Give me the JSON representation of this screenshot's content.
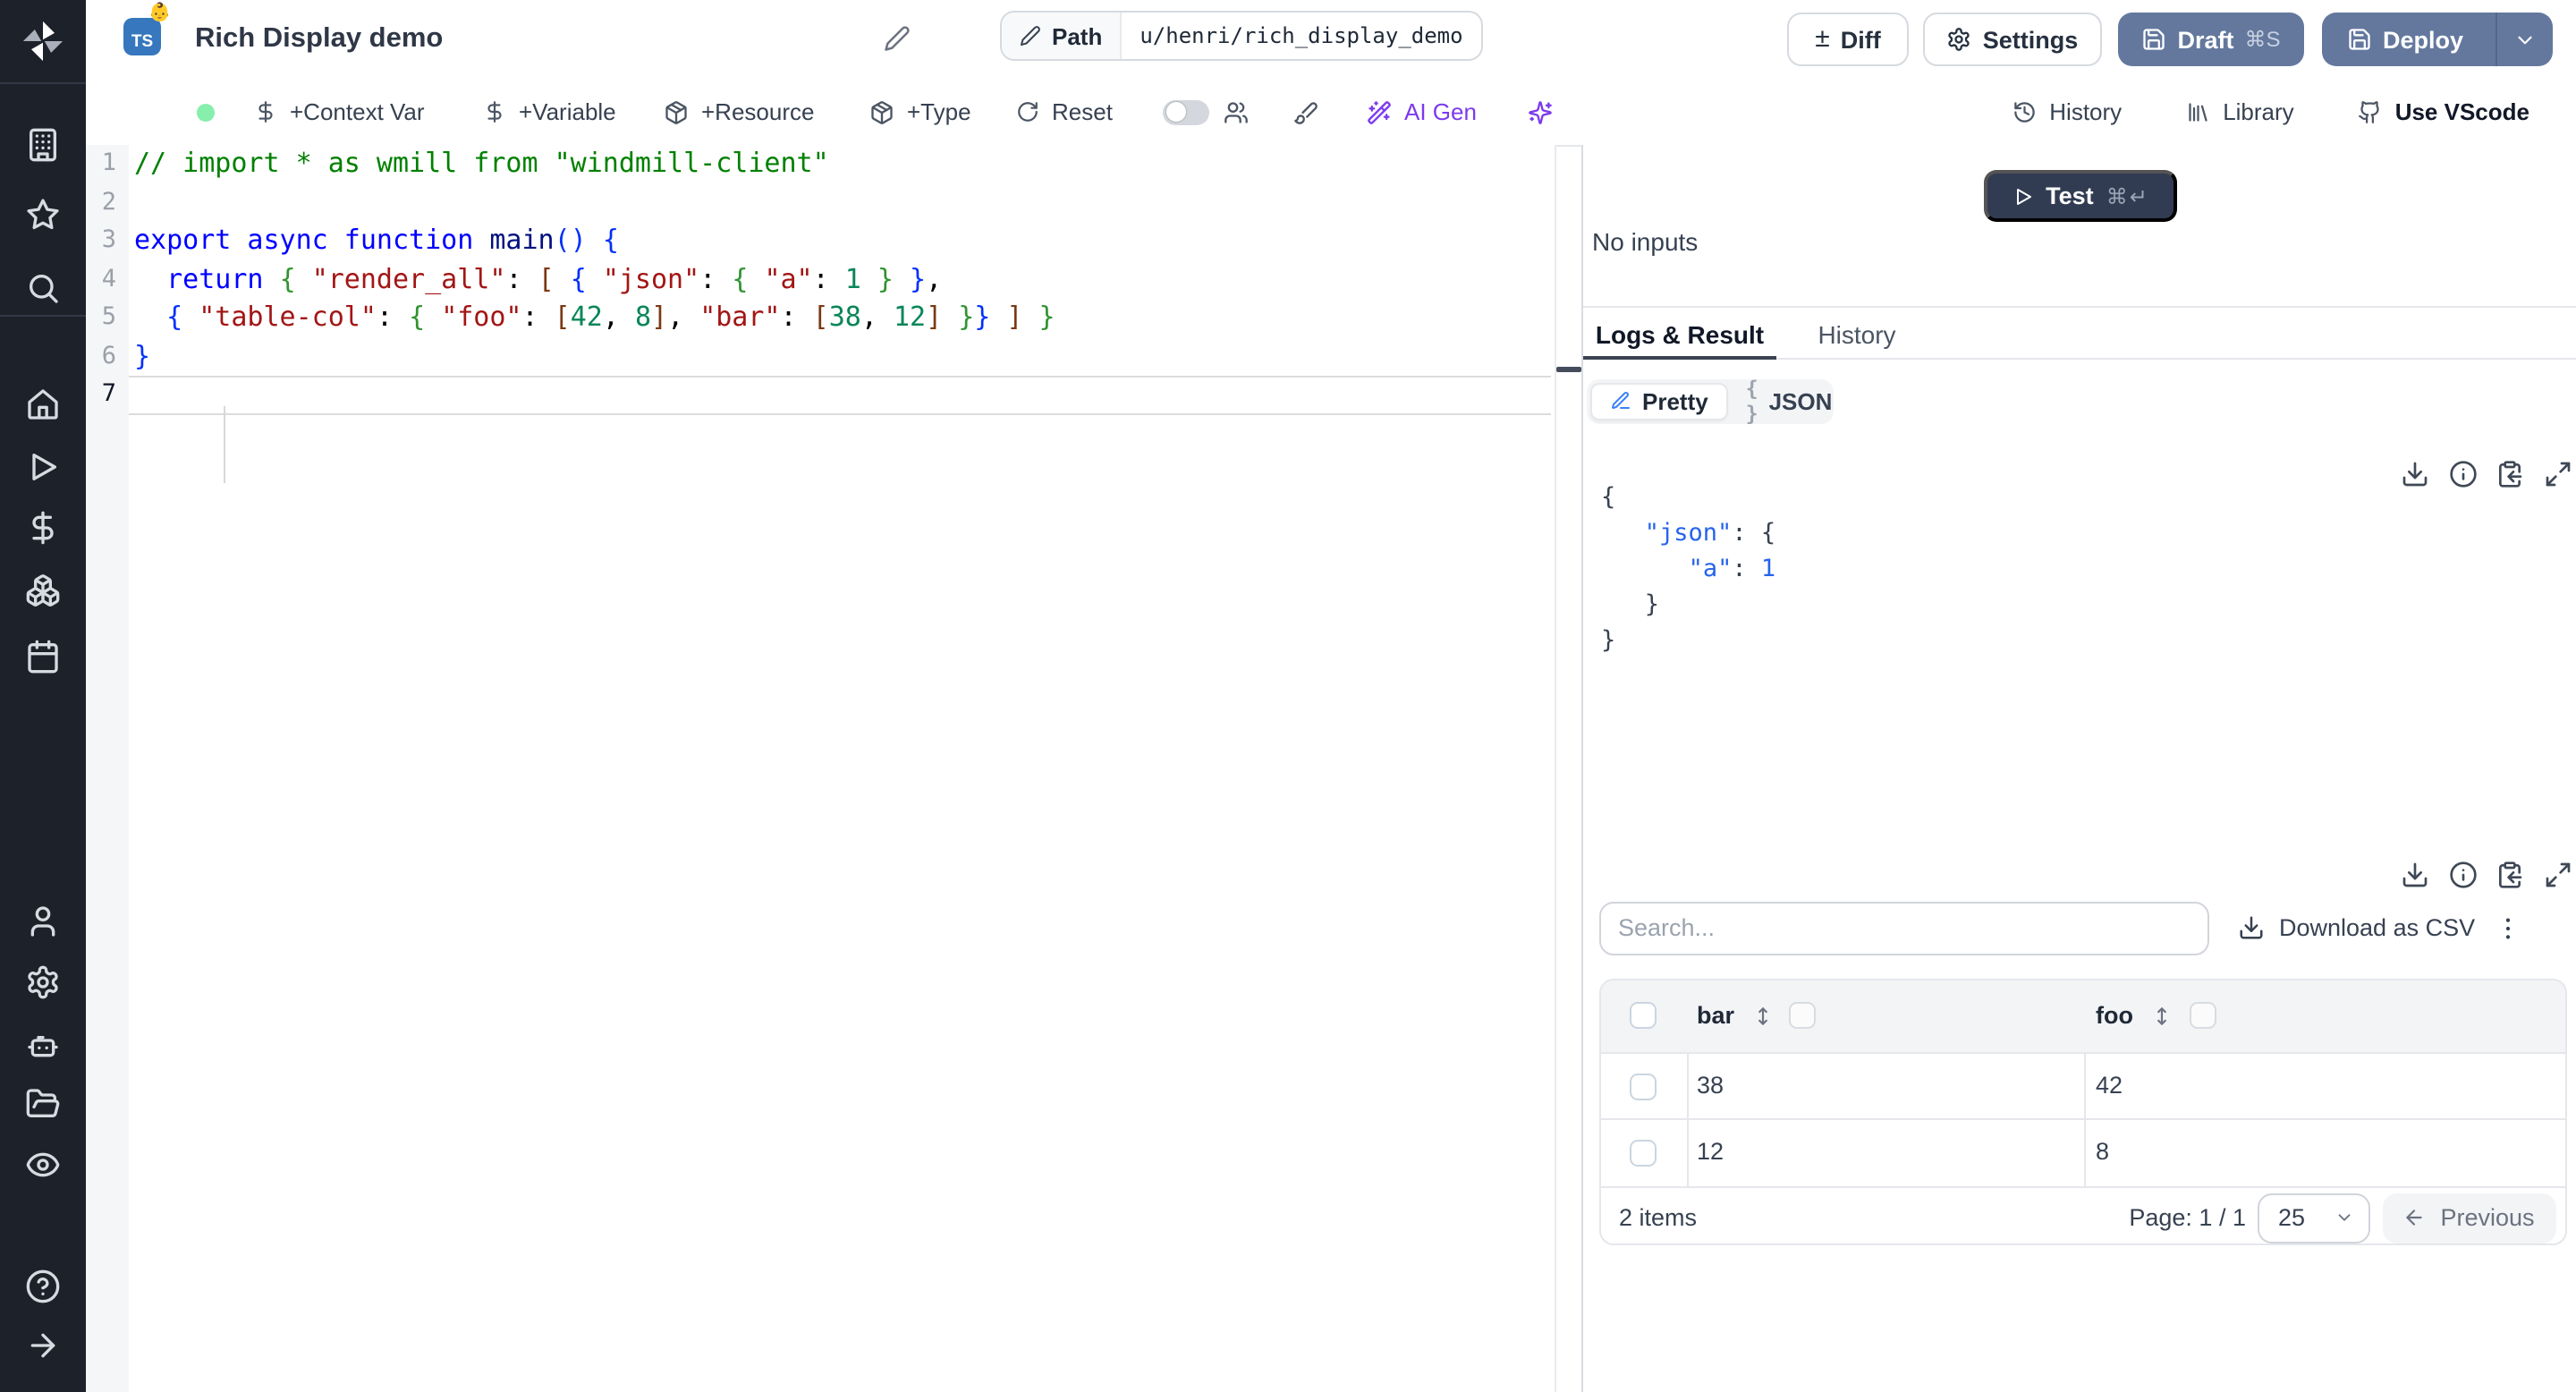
{
  "header": {
    "title": "Rich Display demo",
    "lang_badge": "TS",
    "emoji": "👶",
    "path_label": "Path",
    "path_value": "u/henri/rich_display_demo",
    "diff_label": "Diff",
    "plus_minus": "±",
    "settings_label": "Settings",
    "draft_label": "Draft",
    "draft_shortcut": "⌘S",
    "deploy_label": "Deploy"
  },
  "toolbar": {
    "context_var": "+Context Var",
    "variable": "+Variable",
    "resource": "+Resource",
    "type": "+Type",
    "reset": "Reset",
    "ai_gen": "AI Gen",
    "history": "History",
    "library": "Library",
    "use_vscode": "Use VScode",
    "status_color": "#86efac",
    "accent_purple": "#7c3aed"
  },
  "sidebar": {
    "groups": [
      [
        "building",
        "star",
        "search"
      ],
      [
        "home",
        "play",
        "dollar",
        "cubes",
        "calendar"
      ],
      [
        "user",
        "gear",
        "robot",
        "folder",
        "eye"
      ],
      [
        "help",
        "arrow-right"
      ]
    ],
    "background": "#1d212a"
  },
  "editor": {
    "active_line": 7,
    "line_numbers": [
      "1",
      "2",
      "3",
      "4",
      "5",
      "6",
      "7"
    ],
    "lines": [
      [
        [
          "// import * as wmill from \"windmill-client\"",
          "c"
        ]
      ],
      [],
      [
        [
          "export async function ",
          "k"
        ],
        [
          "main",
          "i"
        ],
        [
          "(",
          "b1"
        ],
        [
          ")",
          "b1"
        ],
        [
          " ",
          "p"
        ],
        [
          "{",
          "b1"
        ]
      ],
      [
        [
          "  ",
          "p"
        ],
        [
          "return",
          "k"
        ],
        [
          " ",
          "p"
        ],
        [
          "{",
          "b2"
        ],
        [
          " ",
          "p"
        ],
        [
          "\"render_all\"",
          "s"
        ],
        [
          ":",
          "p"
        ],
        [
          " ",
          "p"
        ],
        [
          "[",
          "b3"
        ],
        [
          " ",
          "p"
        ],
        [
          "{",
          "b1"
        ],
        [
          " ",
          "p"
        ],
        [
          "\"json\"",
          "s"
        ],
        [
          ":",
          "p"
        ],
        [
          " ",
          "p"
        ],
        [
          "{",
          "b2"
        ],
        [
          " ",
          "p"
        ],
        [
          "\"a\"",
          "s"
        ],
        [
          ":",
          "p"
        ],
        [
          " ",
          "p"
        ],
        [
          "1",
          "n"
        ],
        [
          " ",
          "p"
        ],
        [
          "}",
          "b2"
        ],
        [
          " ",
          "p"
        ],
        [
          "}",
          "b1"
        ],
        [
          ",",
          "p"
        ]
      ],
      [
        [
          "  ",
          "p"
        ],
        [
          "{",
          "b1"
        ],
        [
          " ",
          "p"
        ],
        [
          "\"table-col\"",
          "s"
        ],
        [
          ":",
          "p"
        ],
        [
          " ",
          "p"
        ],
        [
          "{",
          "b2"
        ],
        [
          " ",
          "p"
        ],
        [
          "\"foo\"",
          "s"
        ],
        [
          ":",
          "p"
        ],
        [
          " ",
          "p"
        ],
        [
          "[",
          "b3"
        ],
        [
          "42",
          "n"
        ],
        [
          ",",
          "p"
        ],
        [
          " ",
          "p"
        ],
        [
          "8",
          "n"
        ],
        [
          "]",
          "b3"
        ],
        [
          ",",
          "p"
        ],
        [
          " ",
          "p"
        ],
        [
          "\"bar\"",
          "s"
        ],
        [
          ":",
          "p"
        ],
        [
          " ",
          "p"
        ],
        [
          "[",
          "b3"
        ],
        [
          "38",
          "n"
        ],
        [
          ",",
          "p"
        ],
        [
          " ",
          "p"
        ],
        [
          "12",
          "n"
        ],
        [
          "]",
          "b3"
        ],
        [
          " ",
          "p"
        ],
        [
          "}",
          "b2"
        ],
        [
          "}",
          "b1"
        ],
        [
          " ",
          "p"
        ],
        [
          "]",
          "b3"
        ],
        [
          " ",
          "p"
        ],
        [
          "}",
          "b2"
        ]
      ],
      [
        [
          "}",
          "b1"
        ]
      ],
      []
    ]
  },
  "run": {
    "test_label": "Test",
    "test_shortcut": "⌘↵",
    "no_inputs": "No inputs"
  },
  "tabs": {
    "logs": "Logs & Result",
    "history": "History"
  },
  "result": {
    "pretty_label": "Pretty",
    "json_label": "JSON",
    "braces_glyph": "{ }",
    "toolbar_icons": [
      "download",
      "info",
      "clipboard-copy",
      "expand"
    ],
    "json_lines": [
      [
        [
          "{",
          "p"
        ]
      ],
      [
        [
          "   ",
          "p"
        ],
        [
          "\"json\"",
          "k"
        ],
        [
          ":",
          "p"
        ],
        [
          " ",
          "p"
        ],
        [
          "{",
          "p"
        ]
      ],
      [
        [
          "      ",
          "p"
        ],
        [
          "\"a\"",
          "k"
        ],
        [
          ":",
          "p"
        ],
        [
          " ",
          "p"
        ],
        [
          "1",
          "v"
        ]
      ],
      [
        [
          "   ",
          "p"
        ],
        [
          "}",
          "p"
        ]
      ],
      [
        [
          "}",
          "p"
        ]
      ]
    ],
    "key_color": "#2563eb"
  },
  "table": {
    "search_placeholder": "Search...",
    "download_csv_label": "Download as CSV",
    "toolbar_icons": [
      "download",
      "info",
      "clipboard-copy",
      "expand"
    ],
    "columns": [
      "bar",
      "foo"
    ],
    "rows": [
      [
        "38",
        "42"
      ],
      [
        "12",
        "8"
      ]
    ],
    "items_label": "2 items",
    "page_label": "Page: 1 / 1",
    "page_size": "25",
    "previous_label": "Previous"
  }
}
